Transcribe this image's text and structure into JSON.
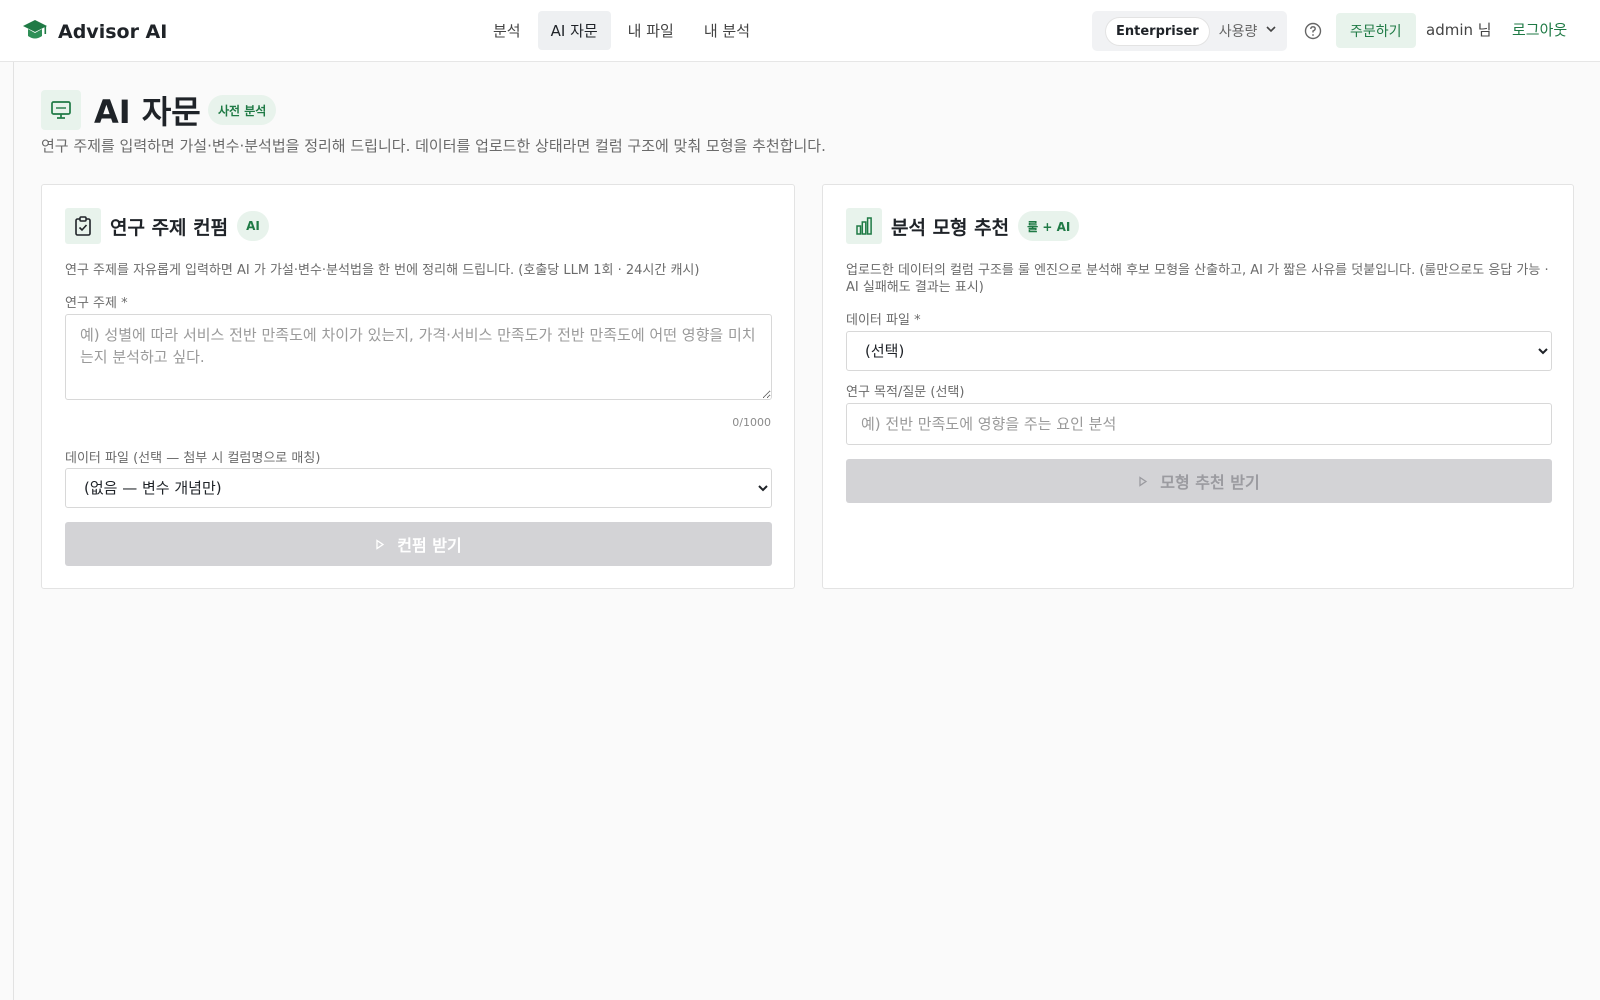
{
  "header": {
    "brand": "Advisor AI",
    "brand_icon": "graduation-cap-icon",
    "nav_tabs": [
      {
        "label": "분석",
        "active": false
      },
      {
        "label": "AI 자문",
        "active": true
      },
      {
        "label": "내 파일",
        "active": false
      },
      {
        "label": "내 분석",
        "active": false
      }
    ],
    "plan_badge": "Enterpriser",
    "usage_label": "사용량",
    "order_button": "주문하기",
    "user": "admin 님",
    "logout": "로그아웃"
  },
  "page": {
    "title": "AI 자문",
    "badge": "사전 분석",
    "subtitle": "연구 주제를 입력하면 가설·변수·분석법을 정리해 드립니다. 데이터를 업로드한 상태라면 컬럼 구조에 맞춰 모형을 추천합니다."
  },
  "consult_card": {
    "title": "연구 주제 컨펌",
    "badge": "AI",
    "description": "연구 주제를 자유롭게 입력하면 AI 가 가설·변수·분석법을 한 번에 정리해 드립니다. (호출당 LLM 1회 · 24시간 캐시)",
    "topic_label": "연구 주제 *",
    "topic_placeholder": "예) 성별에 따라 서비스 전반 만족도에 차이가 있는지, 가격·서비스 만족도가 전반 만족도에 어떤 영향을 미치는지 분석하고 싶다.",
    "counter": "0/1000",
    "file_label": "데이터 파일 (선택 — 첨부 시 컬럼명으로 매칭)",
    "file_selected": "(없음 — 변수 개념만)",
    "submit": "컨펌 받기"
  },
  "model_card": {
    "title": "분석 모형 추천",
    "badge": "룰 + AI",
    "description": "업로드한 데이터의 컬럼 구조를 룰 엔진으로 분석해 후보 모형을 산출하고, AI 가 짧은 사유를 덧붙입니다. (룰만으로도 응답 가능 · AI 실패해도 결과는 표시)",
    "file_label": "데이터 파일 *",
    "file_selected": "(선택)",
    "question_label": "연구 목적/질문 (선택)",
    "question_placeholder": "예) 전반 만족도에 영향을 주는 요인 분석",
    "submit": "모형 추천 받기"
  },
  "colors": {
    "accent": "#1f7a45",
    "accent_bg": "#e8f3ec",
    "disabled": "#d3d3d6"
  }
}
